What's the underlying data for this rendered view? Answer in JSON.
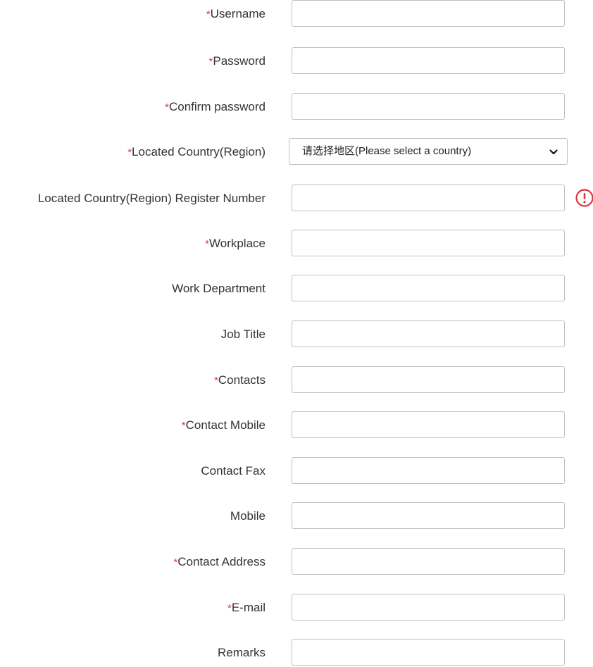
{
  "form": {
    "required_mark": "*",
    "fields": {
      "username": {
        "label": "Username",
        "value": ""
      },
      "password": {
        "label": "Password",
        "value": ""
      },
      "confirm_password": {
        "label": "Confirm password",
        "value": ""
      },
      "country": {
        "label": "Located Country(Region)",
        "selected": "请选择地区(Please select a country)"
      },
      "register_number": {
        "label": "Located Country(Region) Register Number",
        "value": ""
      },
      "workplace": {
        "label": "Workplace",
        "value": ""
      },
      "work_department": {
        "label": "Work Department",
        "value": ""
      },
      "job_title": {
        "label": "Job Title",
        "value": ""
      },
      "contacts": {
        "label": "Contacts",
        "value": ""
      },
      "contact_mobile": {
        "label": "Contact Mobile",
        "value": ""
      },
      "contact_fax": {
        "label": "Contact Fax",
        "value": ""
      },
      "mobile": {
        "label": "Mobile",
        "value": ""
      },
      "contact_address": {
        "label": "Contact Address",
        "value": ""
      },
      "email": {
        "label": "E-mail",
        "value": ""
      },
      "remarks": {
        "label": "Remarks",
        "value": ""
      }
    },
    "icons": {
      "select_arrow": "chevron-down-icon",
      "register_warning": "exclamation-circle-icon"
    },
    "colors": {
      "required": "#e23b3b",
      "warning": "#d9363e",
      "label_text": "#333333",
      "field_border": "#bfbfbf"
    }
  }
}
